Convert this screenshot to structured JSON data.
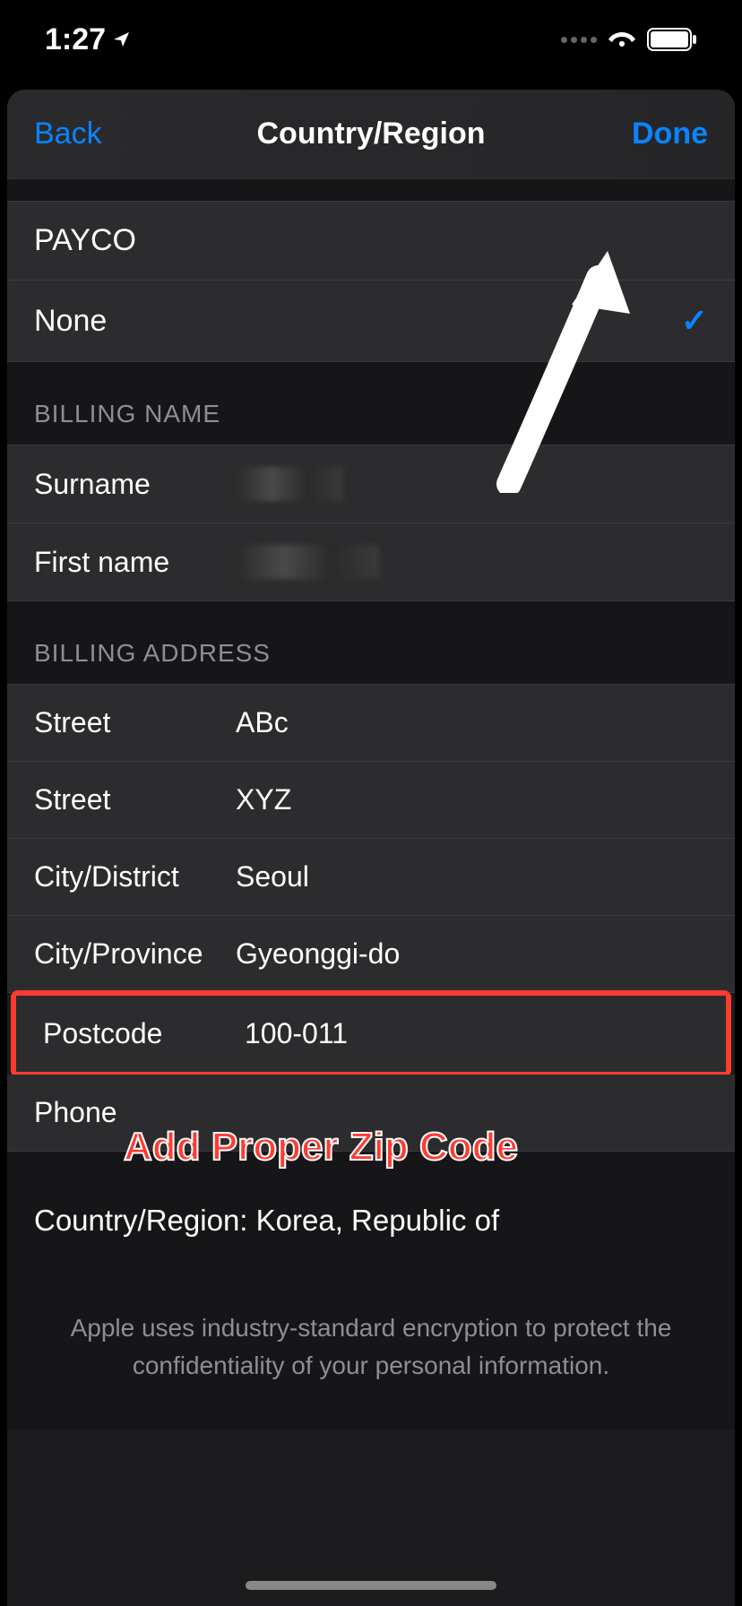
{
  "status": {
    "time": "1:27"
  },
  "nav": {
    "back": "Back",
    "title": "Country/Region",
    "done": "Done"
  },
  "payment": {
    "payco": "PAYCO",
    "none": "None"
  },
  "billing_name": {
    "header": "BILLING NAME",
    "surname_label": "Surname",
    "firstname_label": "First name"
  },
  "billing_address": {
    "header": "BILLING ADDRESS",
    "street1_label": "Street",
    "street1_value": "ABc",
    "street2_label": "Street",
    "street2_value": "XYZ",
    "city_district_label": "City/District",
    "city_district_value": "Seoul",
    "city_province_label": "City/Province",
    "city_province_value": "Gyeonggi-do",
    "postcode_label": "Postcode",
    "postcode_value": "100-011",
    "phone_label": "Phone"
  },
  "country": {
    "text": "Country/Region: Korea, Republic of"
  },
  "footer": {
    "text": "Apple uses industry-standard encryption to protect the confidentiality of your personal information."
  },
  "annotation": {
    "text": "Add Proper Zip Code"
  }
}
